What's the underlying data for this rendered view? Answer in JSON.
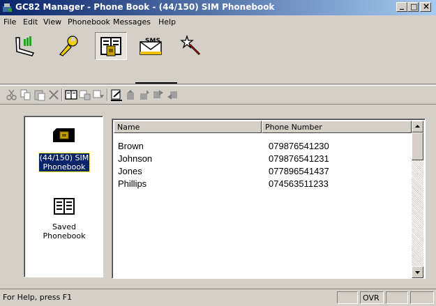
{
  "window": {
    "title": "GC82 Manager - Phone Book - (44/150) SIM Phonebook",
    "minimize_glyph": "_",
    "maximize_glyph": "□",
    "close_glyph": "×"
  },
  "menu": [
    "File",
    "Edit",
    "View",
    "Phonebook",
    "Messages",
    "Help"
  ],
  "big_toolbar": {
    "buttons": [
      "phone-connection-icon",
      "settings-wrench-icon",
      "phonebook-icon",
      "sms-envelope-icon",
      "wizard-wand-icon"
    ],
    "active": "phonebook-icon",
    "sms_text": "SMS"
  },
  "small_toolbar": {
    "buttons": [
      "cut-icon",
      "copy-icon",
      "paste-icon",
      "delete-icon",
      "open-phonebook-icon",
      "copy-to-sim-icon",
      "copy-to-saved-icon",
      "edit-entry-icon",
      "move-up-icon",
      "move-down-icon",
      "send-icon",
      "receive-icon"
    ]
  },
  "left_panel": {
    "items": [
      {
        "label_line1": "(44/150) SIM",
        "label_line2": "Phonebook",
        "icon": "sim-card-icon",
        "selected": true
      },
      {
        "label_line1": "Saved",
        "label_line2": "Phonebook",
        "icon": "book-icon",
        "selected": false
      }
    ]
  },
  "list": {
    "columns": [
      "Name",
      "Phone Number"
    ],
    "rows": [
      {
        "name": "Brown",
        "phone": "079876541230"
      },
      {
        "name": "Johnson",
        "phone": "079876541231"
      },
      {
        "name": "Jones",
        "phone": "077896541437"
      },
      {
        "name": "Phillips",
        "phone": "074563511233"
      }
    ]
  },
  "statusbar": {
    "help": "For Help, press F1",
    "ovr": "OVR"
  }
}
